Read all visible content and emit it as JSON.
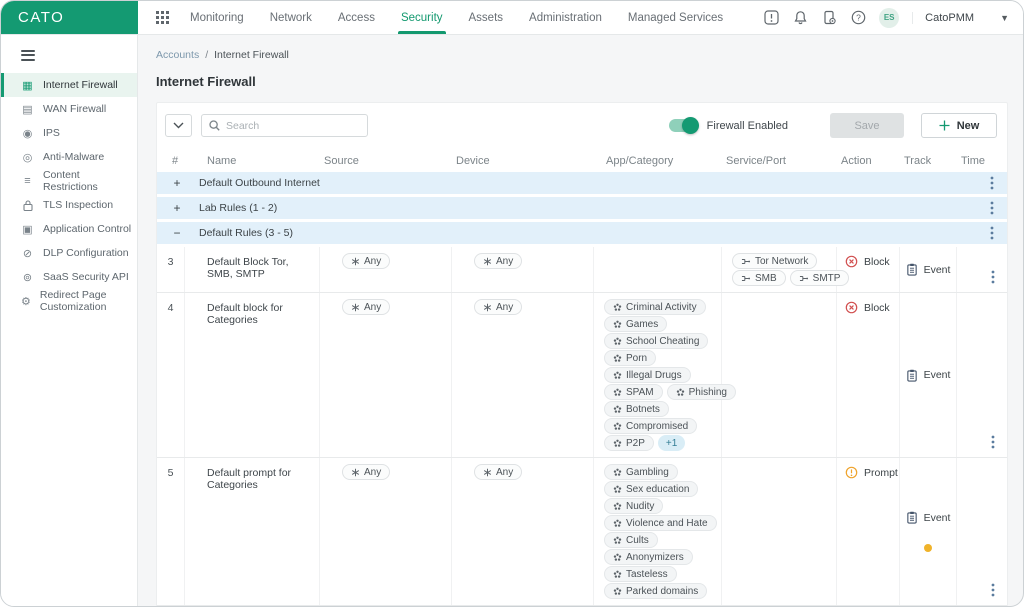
{
  "topbar": {
    "logo": "CATO",
    "nav": [
      {
        "label": "Monitoring",
        "active": false
      },
      {
        "label": "Network",
        "active": false
      },
      {
        "label": "Access",
        "active": false
      },
      {
        "label": "Security",
        "active": true
      },
      {
        "label": "Assets",
        "active": false
      },
      {
        "label": "Administration",
        "active": false
      },
      {
        "label": "Managed Services",
        "active": false
      }
    ],
    "icons": [
      "release-notes-icon",
      "notifications-bell-icon",
      "device-status-icon",
      "help-icon"
    ],
    "avatar_initials": "ES",
    "account": "CatoPMM"
  },
  "sidebar": {
    "items": [
      {
        "label": "Internet Firewall",
        "icon": "internet-firewall",
        "active": true
      },
      {
        "label": "WAN Firewall",
        "icon": "wan-firewall",
        "active": false
      },
      {
        "label": "IPS",
        "icon": "ips",
        "active": false
      },
      {
        "label": "Anti-Malware",
        "icon": "anti-malware",
        "active": false
      },
      {
        "label": "Content Restrictions",
        "icon": "content-restrictions",
        "active": false
      },
      {
        "label": "TLS Inspection",
        "icon": "tls-inspection",
        "active": false
      },
      {
        "label": "Application Control",
        "icon": "application-control",
        "active": false
      },
      {
        "label": "DLP Configuration",
        "icon": "dlp-configuration",
        "active": false
      },
      {
        "label": "SaaS Security API",
        "icon": "saas-security-api",
        "active": false
      },
      {
        "label": "Redirect Page Customization",
        "icon": "redirect-page-customization",
        "active": false
      }
    ]
  },
  "breadcrumb": {
    "link": "Accounts",
    "separator": "/",
    "current": "Internet Firewall"
  },
  "page": {
    "title": "Internet Firewall"
  },
  "toolbar": {
    "search_placeholder": "Search",
    "firewall_toggle_label": "Firewall Enabled",
    "firewall_enabled": true,
    "save_label": "Save",
    "new_label": "New"
  },
  "table": {
    "columns": [
      "#",
      "Name",
      "Source",
      "Device",
      "App/Category",
      "Service/Port",
      "Action",
      "Track",
      "Time"
    ],
    "rows": [
      {
        "type": "group",
        "expanded": false,
        "name": "Default Outbound Internet"
      },
      {
        "type": "group",
        "expanded": false,
        "name": "Lab Rules (1 - 2)"
      },
      {
        "type": "group",
        "expanded": true,
        "name": "Default Rules (3 - 5)"
      },
      {
        "type": "rule",
        "index": "3",
        "name": "Default Block Tor, SMB, SMTP",
        "source": [
          [
            "Any"
          ]
        ],
        "device": [
          [
            "Any"
          ]
        ],
        "app_category": [],
        "service_port": [
          [
            "Tor Network"
          ],
          [
            "SMB",
            "SMTP"
          ]
        ],
        "action": {
          "label": "Block",
          "kind": "block"
        },
        "track": {
          "label": "Event",
          "dot": false
        }
      },
      {
        "type": "rule",
        "index": "4",
        "name": "Default block for Categories",
        "source": [
          [
            "Any"
          ]
        ],
        "device": [
          [
            "Any"
          ]
        ],
        "app_category": [
          [
            "Criminal Activity"
          ],
          [
            "Games"
          ],
          [
            "School Cheating"
          ],
          [
            "Porn"
          ],
          [
            "Illegal Drugs"
          ],
          [
            "SPAM",
            "Phishing"
          ],
          [
            "Botnets"
          ],
          [
            "Compromised"
          ],
          [
            "P2P",
            "+1"
          ]
        ],
        "service_port": [],
        "action": {
          "label": "Block",
          "kind": "block"
        },
        "track": {
          "label": "Event",
          "dot": false
        }
      },
      {
        "type": "rule",
        "index": "5",
        "name": "Default prompt for Categories",
        "source": [
          [
            "Any"
          ]
        ],
        "device": [
          [
            "Any"
          ]
        ],
        "app_category": [
          [
            "Gambling"
          ],
          [
            "Sex education"
          ],
          [
            "Nudity"
          ],
          [
            "Violence and Hate"
          ],
          [
            "Cults"
          ],
          [
            "Anonymizers"
          ],
          [
            "Tasteless"
          ],
          [
            "Parked domains"
          ]
        ],
        "service_port": [],
        "action": {
          "label": "Prompt",
          "kind": "prompt"
        },
        "track": {
          "label": "Event",
          "dot": true
        }
      }
    ]
  },
  "colors": {
    "brand_green": "#149a72",
    "group_row_blue": "#e2f0fa",
    "block_red": "#d14f4f",
    "prompt_orange": "#efa32b",
    "track_dot_yellow": "#f0b32a",
    "more_chip_blue": "#d9edf6"
  }
}
